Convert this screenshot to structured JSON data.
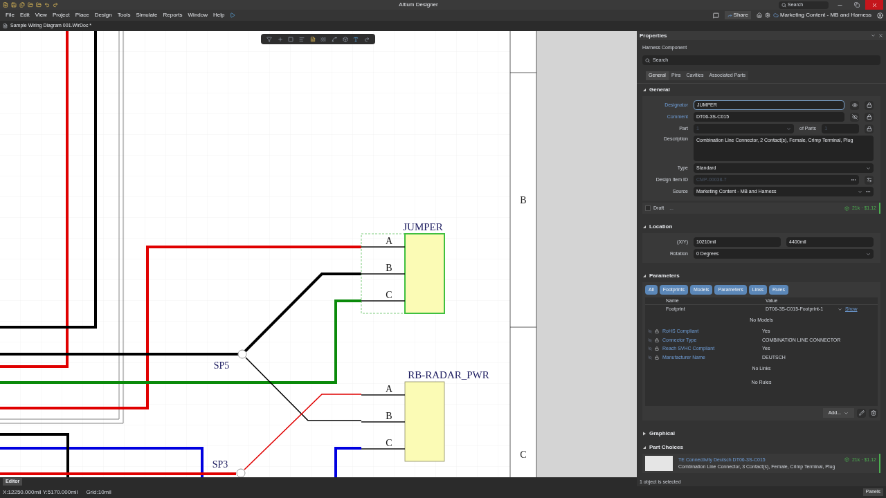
{
  "title_bar": {
    "title": "Altium Designer",
    "search_placeholder": "Search"
  },
  "menu": [
    "File",
    "Edit",
    "View",
    "Project",
    "Place",
    "Design",
    "Tools",
    "Simulate",
    "Reports",
    "Window",
    "Help"
  ],
  "toolbar_right": {
    "share": "Share",
    "workspace": "Marketing Content - MB and Harness"
  },
  "document_tab": {
    "title": "Sample Wiring Diagram 001.WirDoc *"
  },
  "diagram": {
    "connectors": [
      {
        "designator": "JUMPER",
        "selected": true,
        "pins": [
          "A",
          "B",
          "C"
        ]
      },
      {
        "designator": "RB-RADAR_PWR",
        "selected": false,
        "pins": [
          "A",
          "B",
          "C"
        ]
      }
    ],
    "splices": [
      "SP5",
      "SP3"
    ],
    "zones": [
      "B",
      "C"
    ]
  },
  "properties": {
    "title": "Properties",
    "object_type": "Harness Component",
    "search_placeholder": "Search",
    "tabs": [
      {
        "label": "General",
        "selected": true
      },
      {
        "label": "Pins",
        "selected": false
      },
      {
        "label": "Cavities",
        "selected": false
      },
      {
        "label": "Associated Parts",
        "selected": false
      }
    ],
    "general": {
      "title": "General",
      "expanded": true,
      "designator_label": "Designator",
      "designator": "JUMPER",
      "comment_label": "Comment",
      "comment": "DT06-3S-C015",
      "part_label": "Part",
      "part": "1",
      "of_parts_label": "of Parts",
      "of_parts": "1",
      "description_label": "Description",
      "description": "Combination Line Connector, 2 Contact(s), Female, Crimp Terminal, Plug",
      "type_label": "Type",
      "type": "Standard",
      "design_item_label": "Design Item ID",
      "design_item_id": "CMP-00038-7",
      "source_label": "Source",
      "source": "Marketing Content - MB and Harness",
      "draft_label": "Draft",
      "draft_checked": false,
      "draft_more": "...",
      "price": "21k · $1.12"
    },
    "location": {
      "title": "Location",
      "expanded": true,
      "xy_label": "(X/Y)",
      "x": "10210mil",
      "y": "4400mil",
      "rotation_label": "Rotation",
      "rotation": "0 Degrees"
    },
    "parameters": {
      "title": "Parameters",
      "expanded": true,
      "filters": [
        {
          "label": "All",
          "selected": true
        },
        {
          "label": "Footprints",
          "selected": true
        },
        {
          "label": "Models",
          "selected": true
        },
        {
          "label": "Parameters",
          "selected": true
        },
        {
          "label": "Links",
          "selected": true
        },
        {
          "label": "Rules",
          "selected": true
        }
      ],
      "columns": [
        "Name",
        "Value"
      ],
      "footprint": {
        "name": "Footprint",
        "value": "DT06-3S-C015-Footprint-1",
        "link": "Show"
      },
      "no_models": "No Models",
      "rows": [
        {
          "name": "RoHS Compliant",
          "value": "Yes"
        },
        {
          "name": "Connector Type",
          "value": "COMBINATION LINE CONNECTOR"
        },
        {
          "name": "Reach SVHC Compliant",
          "value": "Yes"
        },
        {
          "name": "Manufacturer Name",
          "value": "DEUTSCH"
        }
      ],
      "no_links": "No Links",
      "no_rules": "No Rules",
      "add_button": "Add..."
    },
    "graphical": {
      "title": "Graphical",
      "expanded": false
    },
    "part_choices": {
      "title": "Part Choices",
      "expanded": true,
      "items": [
        {
          "name": "TE Connectivity Deutsch DT06-3S-C015",
          "description": "Combination Line Connector, 3 Contact(s), Female, Crimp Terminal, Plug",
          "price": "21k · $1.12"
        }
      ]
    },
    "selection_status": "1 object is selected"
  },
  "status_bar": {
    "editor_tab": "Editor",
    "coordinates": "X:12250.000mil Y:5170.000mil",
    "grid": "Grid:10mil",
    "panels_button": "Panels"
  }
}
